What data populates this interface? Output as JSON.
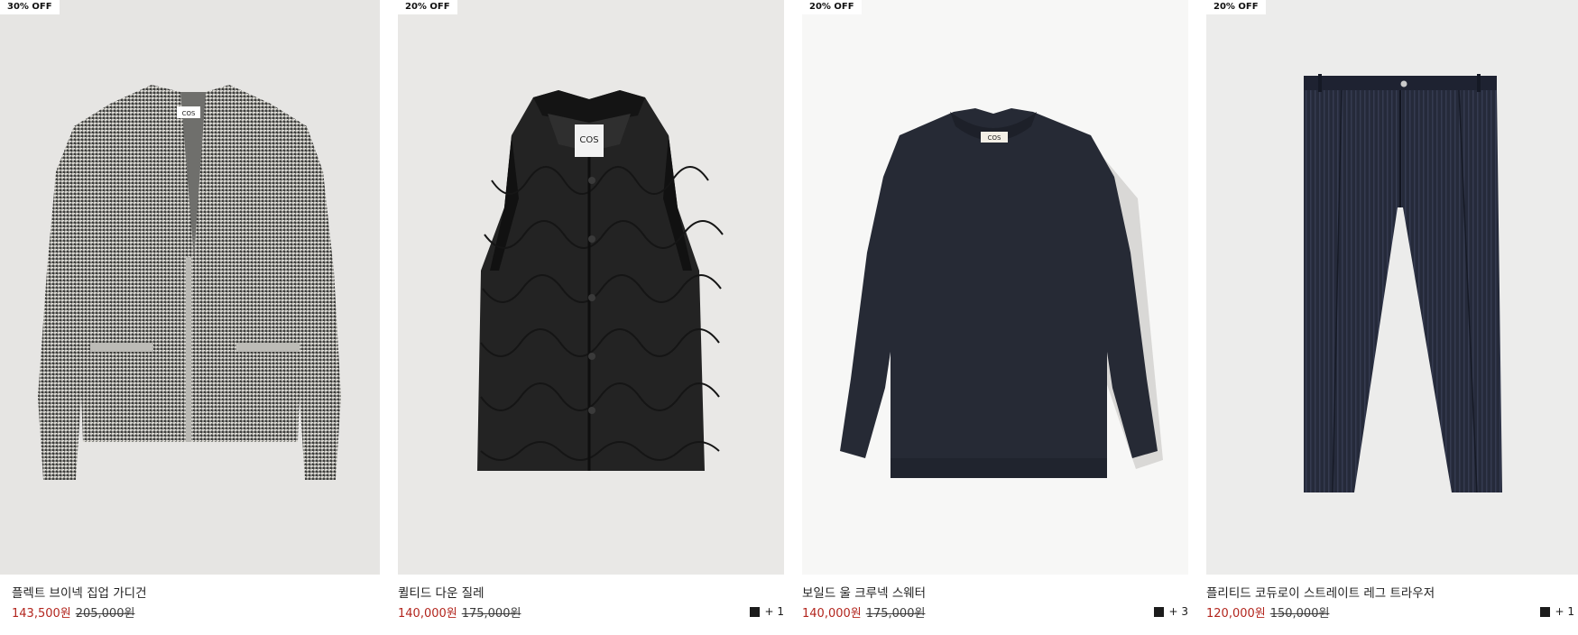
{
  "products": [
    {
      "badge": "30% OFF",
      "name": "플렉트 브이넥 집업 가디건",
      "sale_price": "143,500원",
      "original_price": "205,000원",
      "colors_more": "",
      "image_icon": "grey-knit-cardigan-image"
    },
    {
      "badge": "20% OFF",
      "name": "퀼티드 다운 질레",
      "sale_price": "140,000원",
      "original_price": "175,000원",
      "colors_more": "+ 1",
      "image_icon": "black-quilted-vest-image"
    },
    {
      "badge": "20% OFF",
      "name": "보일드 울 크루넥 스웨터",
      "sale_price": "140,000원",
      "original_price": "175,000원",
      "colors_more": "+ 3",
      "image_icon": "navy-wool-sweater-image"
    },
    {
      "badge": "20% OFF",
      "name": "플리티드 코듀로이 스트레이트 레그 트라우저",
      "sale_price": "120,000원",
      "original_price": "150,000원",
      "colors_more": "+ 1",
      "image_icon": "navy-corduroy-trousers-image"
    }
  ],
  "colors": {
    "sale": "#b3261e",
    "swatch": "#1c1c1c"
  }
}
